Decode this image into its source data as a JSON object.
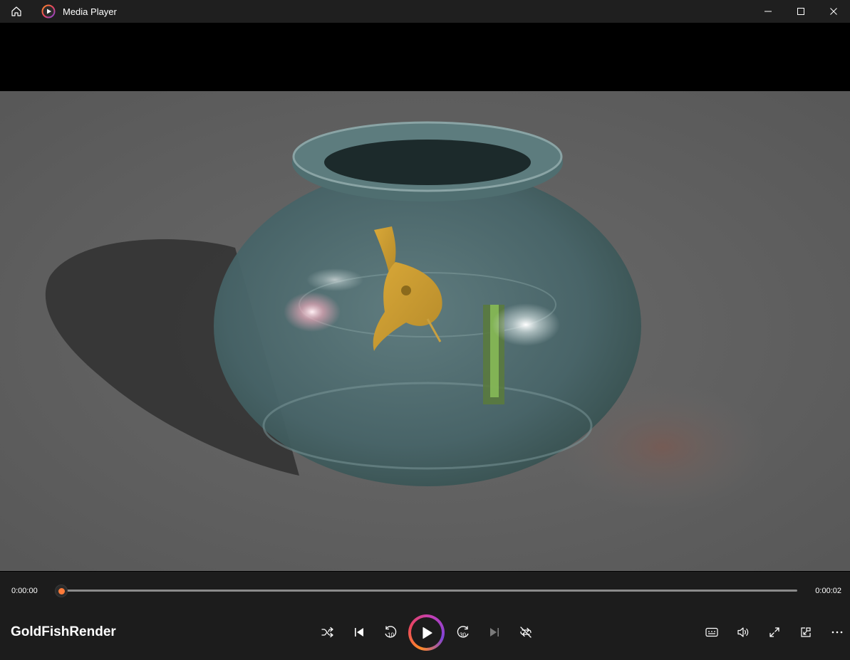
{
  "window": {
    "title": "Media Player"
  },
  "player": {
    "media_title": "GoldFishRender",
    "time_elapsed": "0:00:00",
    "time_total": "0:00:02",
    "progress": 0.0
  },
  "colors": {
    "accent": "#ff7b3a",
    "titlebar_bg": "#1f1f1f",
    "controls_bg": "#1c1c1c",
    "video_letterbox": "#000000"
  },
  "icons": {
    "home": "home-icon",
    "app": "media-player-app-icon",
    "minimize": "minimize-icon",
    "maximize": "maximize-icon",
    "close": "close-icon",
    "shuffle": "shuffle-icon",
    "previous": "previous-track-icon",
    "skip_back": "skip-back-10-icon",
    "play": "play-icon",
    "skip_forward": "skip-forward-30-icon",
    "next": "next-track-icon",
    "repeat": "repeat-off-icon",
    "subtitles": "subtitles-icon",
    "volume": "volume-icon",
    "fullscreen": "fullscreen-icon",
    "mini_player": "mini-player-icon",
    "more": "more-options-icon"
  },
  "skip_labels": {
    "back": "10",
    "forward": "30"
  }
}
